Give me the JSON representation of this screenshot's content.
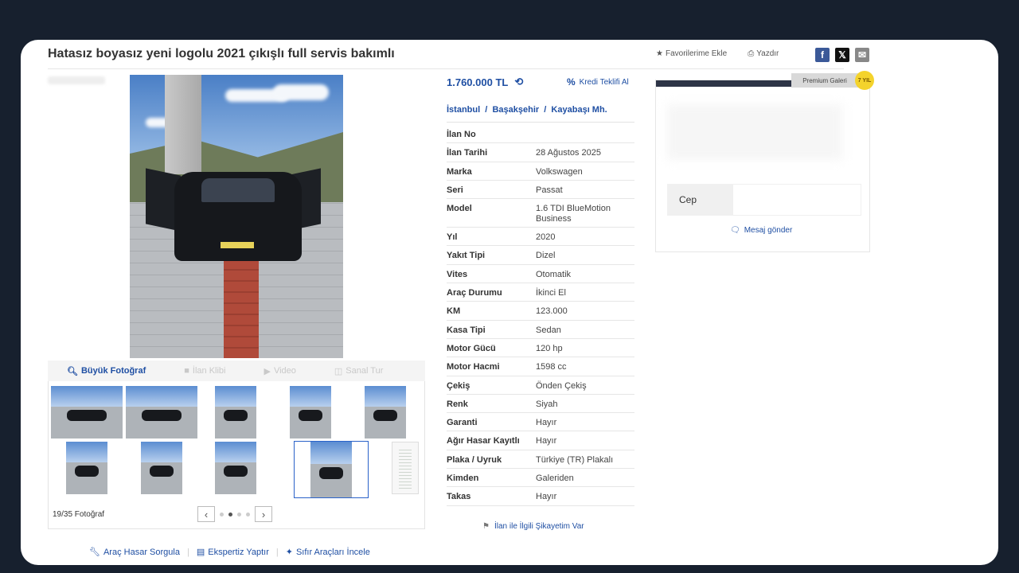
{
  "title": "Hatasız boyasız yeni logolu 2021 çıkışlı full servis bakımlı",
  "actions": {
    "favorite": "Favorilerime Ekle",
    "print": "Yazdır"
  },
  "share": {
    "facebook": "f",
    "x": "𝕏",
    "email": "✉"
  },
  "price": "1.760.000 TL",
  "kredi": {
    "icon": "%",
    "label": "Kredi Teklifi Al"
  },
  "location": "İstanbul  /  Başakşehir  /  Kayabaşı Mh.",
  "specs": [
    {
      "k": "İlan No",
      "v": ""
    },
    {
      "k": "İlan Tarihi",
      "v": "28 Ağustos 2025"
    },
    {
      "k": "Marka",
      "v": "Volkswagen"
    },
    {
      "k": "Seri",
      "v": "Passat"
    },
    {
      "k": "Model",
      "v": "1.6 TDI BlueMotion Business"
    },
    {
      "k": "Yıl",
      "v": "2020"
    },
    {
      "k": "Yakıt Tipi",
      "v": "Dizel"
    },
    {
      "k": "Vites",
      "v": "Otomatik"
    },
    {
      "k": "Araç Durumu",
      "v": "İkinci El"
    },
    {
      "k": "KM",
      "v": "123.000"
    },
    {
      "k": "Kasa Tipi",
      "v": "Sedan"
    },
    {
      "k": "Motor Gücü",
      "v": "120 hp"
    },
    {
      "k": "Motor Hacmi",
      "v": "1598 cc"
    },
    {
      "k": "Çekiş",
      "v": "Önden Çekiş"
    },
    {
      "k": "Renk",
      "v": "Siyah"
    },
    {
      "k": "Garanti",
      "v": "Hayır"
    },
    {
      "k": "Ağır Hasar Kayıtlı",
      "v": "Hayır"
    },
    {
      "k": "Plaka / Uyruk",
      "v": "Türkiye (TR) Plakalı"
    },
    {
      "k": "Kimden",
      "v": "Galeriden"
    },
    {
      "k": "Takas",
      "v": "Hayır"
    }
  ],
  "complaint": "İlan ile İlgili Şikayetim Var",
  "photo_tools": {
    "big_photo": "Büyük Fotoğraf",
    "video_clip": "İlan Klibi",
    "video": "Video",
    "virtual_tour": "Sanal Tur"
  },
  "photo_count": "19/35 Fotoğraf",
  "pager": {
    "prev": "‹",
    "next": "›",
    "active_dot": 2,
    "dots": 4
  },
  "bottom_links": {
    "damage": "Araç Hasar Sorgula",
    "expertise": "Ekspertiz Yaptır",
    "new_cars": "Sıfır Araçları İncele"
  },
  "seller": {
    "badge": "Premium Galeri",
    "badge_icon": "7 YIL",
    "phone_label": "Cep",
    "message": "Mesaj gönder"
  },
  "colors": {
    "accent": "#1f4fa3",
    "badge": "#f4d32c",
    "dark": "#2d3446"
  }
}
